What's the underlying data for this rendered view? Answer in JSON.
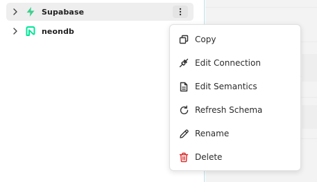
{
  "sidebar": {
    "items": [
      {
        "label": "Supabase",
        "icon": "supabase-bolt-icon",
        "icon_color": "#3ecf8e",
        "selected": true
      },
      {
        "label": "neondb",
        "icon": "neon-logo-icon",
        "icon_color": "#00e599",
        "selected": false
      }
    ],
    "more_icon": "vertical-dots-icon"
  },
  "context_menu": {
    "items": [
      {
        "label": "Copy",
        "icon": "copy-icon"
      },
      {
        "label": "Edit Connection",
        "icon": "plug-icon"
      },
      {
        "label": "Edit Semantics",
        "icon": "document-icon"
      },
      {
        "label": "Refresh Schema",
        "icon": "refresh-icon"
      },
      {
        "label": "Rename",
        "icon": "pencil-icon"
      },
      {
        "label": "Delete",
        "icon": "trash-icon",
        "icon_color": "#dc2626"
      }
    ]
  },
  "colors": {
    "sidebar_border": "#b9dfe6",
    "selected_row": "#eeeeee",
    "right_panel": "#f3f3f3"
  }
}
